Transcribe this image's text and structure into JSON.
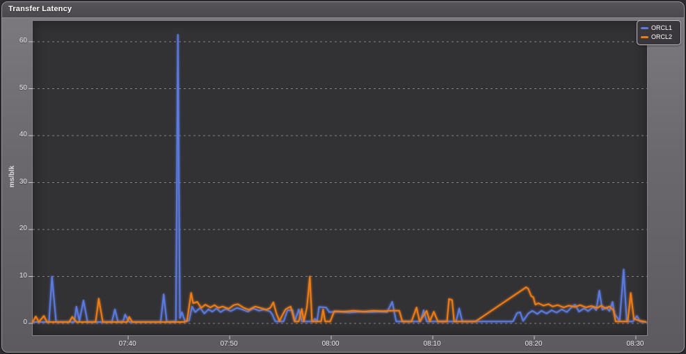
{
  "window": {
    "title": "Transfer Latency"
  },
  "colors": {
    "series_blue": "#5b7be0",
    "series_orange": "#ef7d16",
    "plot_background": "#323134",
    "panel_background": "#6b696e",
    "gridline": "#d8d8dc"
  },
  "chart_data": {
    "type": "line",
    "title": "Transfer Latency",
    "xlabel": "",
    "ylabel": "ms/blk",
    "grid": "horizontal dashed",
    "legend_position": "top-right",
    "x_axis": {
      "unit": "time of day, minutes after 07:30",
      "range": [
        0.6,
        61.1
      ],
      "tick_positions": [
        10,
        20,
        30,
        40,
        50,
        60
      ],
      "tick_labels": [
        "07:40",
        "07:50",
        "08:00",
        "08:10",
        "08:20",
        "08:30"
      ]
    },
    "y_axis": {
      "ticks": [
        0,
        10,
        20,
        30,
        40,
        50,
        60
      ],
      "range": [
        0,
        60
      ]
    },
    "series": [
      {
        "name": "ORCL1",
        "color": "#5b7be0",
        "points": [
          [
            0.6,
            0.3
          ],
          [
            2.2,
            0.3
          ],
          [
            2.5,
            10
          ],
          [
            2.9,
            0.3
          ],
          [
            4.7,
            0.3
          ],
          [
            4.9,
            3.6
          ],
          [
            5.2,
            0.5
          ],
          [
            5.6,
            4.9
          ],
          [
            6.0,
            0.3
          ],
          [
            8.4,
            0.3
          ],
          [
            8.7,
            3.0
          ],
          [
            9.0,
            0.3
          ],
          [
            9.5,
            0.4
          ],
          [
            9.7,
            1.9
          ],
          [
            10.1,
            0.3
          ],
          [
            13.2,
            0.3
          ],
          [
            13.5,
            6.2
          ],
          [
            13.8,
            0.3
          ],
          [
            14.7,
            0.4
          ],
          [
            14.9,
            61.5
          ],
          [
            15.1,
            1.1
          ],
          [
            15.3,
            2.4
          ],
          [
            15.6,
            0.4
          ],
          [
            16.0,
            0.6
          ],
          [
            16.3,
            3.6
          ],
          [
            16.6,
            2.4
          ],
          [
            17.1,
            3.3
          ],
          [
            17.5,
            2.1
          ],
          [
            17.9,
            3.0
          ],
          [
            18.3,
            2.5
          ],
          [
            18.7,
            3.2
          ],
          [
            19.1,
            2.4
          ],
          [
            19.6,
            3.1
          ],
          [
            20.1,
            2.6
          ],
          [
            20.7,
            3.3
          ],
          [
            21.2,
            3.0
          ],
          [
            21.8,
            2.5
          ],
          [
            22.3,
            3.2
          ],
          [
            22.9,
            2.7
          ],
          [
            23.4,
            3.0
          ],
          [
            24.0,
            2.5
          ],
          [
            24.2,
            1.9
          ],
          [
            24.5,
            0.4
          ],
          [
            25.3,
            0.4
          ],
          [
            25.7,
            2.8
          ],
          [
            26.2,
            2.8
          ],
          [
            26.4,
            0.4
          ],
          [
            26.8,
            3.0
          ],
          [
            27.1,
            0.4
          ],
          [
            28.2,
            0.4
          ],
          [
            28.4,
            1.0
          ],
          [
            28.6,
            0.4
          ],
          [
            28.8,
            3.5
          ],
          [
            29.5,
            3.4
          ],
          [
            29.8,
            2.4
          ],
          [
            30.8,
            2.5
          ],
          [
            31.8,
            2.3
          ],
          [
            32.8,
            2.5
          ],
          [
            33.8,
            2.4
          ],
          [
            34.9,
            2.5
          ],
          [
            35.5,
            2.4
          ],
          [
            36.0,
            4.6
          ],
          [
            36.4,
            0.4
          ],
          [
            38.8,
            0.4
          ],
          [
            39.1,
            2.8
          ],
          [
            39.4,
            0.4
          ],
          [
            42.3,
            0.4
          ],
          [
            42.6,
            3.2
          ],
          [
            42.9,
            0.4
          ],
          [
            47.9,
            0.4
          ],
          [
            48.3,
            2.2
          ],
          [
            48.6,
            2.4
          ],
          [
            48.9,
            0.5
          ],
          [
            49.4,
            2.1
          ],
          [
            49.8,
            2.7
          ],
          [
            50.3,
            2.0
          ],
          [
            50.7,
            2.7
          ],
          [
            51.2,
            2.1
          ],
          [
            51.7,
            2.8
          ],
          [
            52.2,
            2.3
          ],
          [
            52.7,
            3.0
          ],
          [
            53.2,
            2.4
          ],
          [
            53.6,
            3.3
          ],
          [
            54.0,
            4.0
          ],
          [
            54.4,
            2.5
          ],
          [
            54.9,
            3.2
          ],
          [
            55.3,
            2.6
          ],
          [
            55.8,
            3.5
          ],
          [
            56.1,
            2.8
          ],
          [
            56.4,
            7.0
          ],
          [
            56.7,
            2.9
          ],
          [
            57.1,
            3.4
          ],
          [
            57.4,
            2.6
          ],
          [
            57.7,
            4.6
          ],
          [
            57.9,
            2.0
          ],
          [
            58.4,
            0.5
          ],
          [
            58.8,
            11.5
          ],
          [
            59.1,
            0.4
          ],
          [
            59.7,
            0.4
          ],
          [
            60.1,
            1.6
          ],
          [
            60.4,
            0.4
          ],
          [
            61.0,
            0.3
          ]
        ]
      },
      {
        "name": "ORCL2",
        "color": "#ef7d16",
        "points": [
          [
            0.6,
            0.3
          ],
          [
            0.9,
            1.5
          ],
          [
            1.2,
            0.3
          ],
          [
            1.7,
            1.6
          ],
          [
            2.0,
            0.3
          ],
          [
            4.2,
            0.3
          ],
          [
            4.5,
            1.4
          ],
          [
            4.9,
            0.3
          ],
          [
            6.8,
            0.3
          ],
          [
            7.1,
            5.3
          ],
          [
            7.5,
            0.3
          ],
          [
            9.9,
            0.3
          ],
          [
            10.1,
            1.4
          ],
          [
            10.4,
            0.3
          ],
          [
            15.5,
            0.3
          ],
          [
            15.8,
            0.5
          ],
          [
            16.2,
            6.5
          ],
          [
            16.4,
            4.3
          ],
          [
            16.8,
            4.6
          ],
          [
            17.2,
            3.3
          ],
          [
            17.6,
            4.0
          ],
          [
            18.1,
            3.4
          ],
          [
            18.5,
            3.9
          ],
          [
            18.9,
            3.3
          ],
          [
            19.3,
            3.6
          ],
          [
            19.9,
            3.1
          ],
          [
            20.4,
            3.9
          ],
          [
            20.8,
            4.1
          ],
          [
            21.4,
            3.3
          ],
          [
            21.9,
            2.9
          ],
          [
            22.5,
            3.6
          ],
          [
            23.0,
            3.3
          ],
          [
            23.6,
            2.9
          ],
          [
            24.0,
            3.3
          ],
          [
            24.3,
            4.5
          ],
          [
            24.6,
            2.1
          ],
          [
            24.9,
            0.5
          ],
          [
            25.2,
            1.8
          ],
          [
            25.5,
            3.0
          ],
          [
            26.0,
            3.6
          ],
          [
            26.4,
            0.4
          ],
          [
            26.8,
            0.4
          ],
          [
            27.1,
            3.1
          ],
          [
            27.3,
            0.4
          ],
          [
            27.6,
            3.4
          ],
          [
            27.9,
            10
          ],
          [
            28.1,
            0.4
          ],
          [
            29.0,
            0.4
          ],
          [
            29.2,
            3.0
          ],
          [
            29.4,
            0.4
          ],
          [
            29.9,
            0.4
          ],
          [
            30.3,
            2.6
          ],
          [
            31.2,
            2.5
          ],
          [
            32.2,
            2.7
          ],
          [
            33.2,
            2.5
          ],
          [
            34.1,
            2.7
          ],
          [
            35.1,
            2.6
          ],
          [
            35.9,
            2.7
          ],
          [
            36.7,
            2.7
          ],
          [
            37.0,
            0.4
          ],
          [
            37.9,
            0.4
          ],
          [
            38.4,
            3.4
          ],
          [
            38.7,
            0.4
          ],
          [
            39.4,
            2.7
          ],
          [
            39.7,
            0.4
          ],
          [
            40.1,
            2.5
          ],
          [
            40.5,
            0.4
          ],
          [
            41.4,
            0.4
          ],
          [
            41.6,
            5.2
          ],
          [
            41.9,
            5.0
          ],
          [
            42.1,
            0.4
          ],
          [
            44.2,
            0.4
          ],
          [
            49.2,
            7.7
          ],
          [
            49.4,
            7.4
          ],
          [
            49.7,
            5.8
          ],
          [
            49.9,
            5.6
          ],
          [
            50.1,
            4.0
          ],
          [
            50.4,
            4.3
          ],
          [
            50.9,
            3.8
          ],
          [
            51.4,
            4.1
          ],
          [
            51.8,
            3.6
          ],
          [
            52.3,
            3.9
          ],
          [
            52.9,
            3.4
          ],
          [
            53.4,
            3.8
          ],
          [
            54.0,
            3.5
          ],
          [
            54.5,
            3.9
          ],
          [
            55.1,
            3.4
          ],
          [
            55.6,
            3.7
          ],
          [
            56.2,
            3.3
          ],
          [
            56.6,
            3.8
          ],
          [
            57.0,
            3.2
          ],
          [
            57.4,
            3.6
          ],
          [
            57.8,
            2.8
          ],
          [
            58.0,
            0.4
          ],
          [
            59.2,
            0.4
          ],
          [
            59.5,
            6.5
          ],
          [
            59.8,
            1.0
          ],
          [
            60.3,
            0.6
          ],
          [
            61.0,
            0.3
          ]
        ]
      }
    ]
  }
}
